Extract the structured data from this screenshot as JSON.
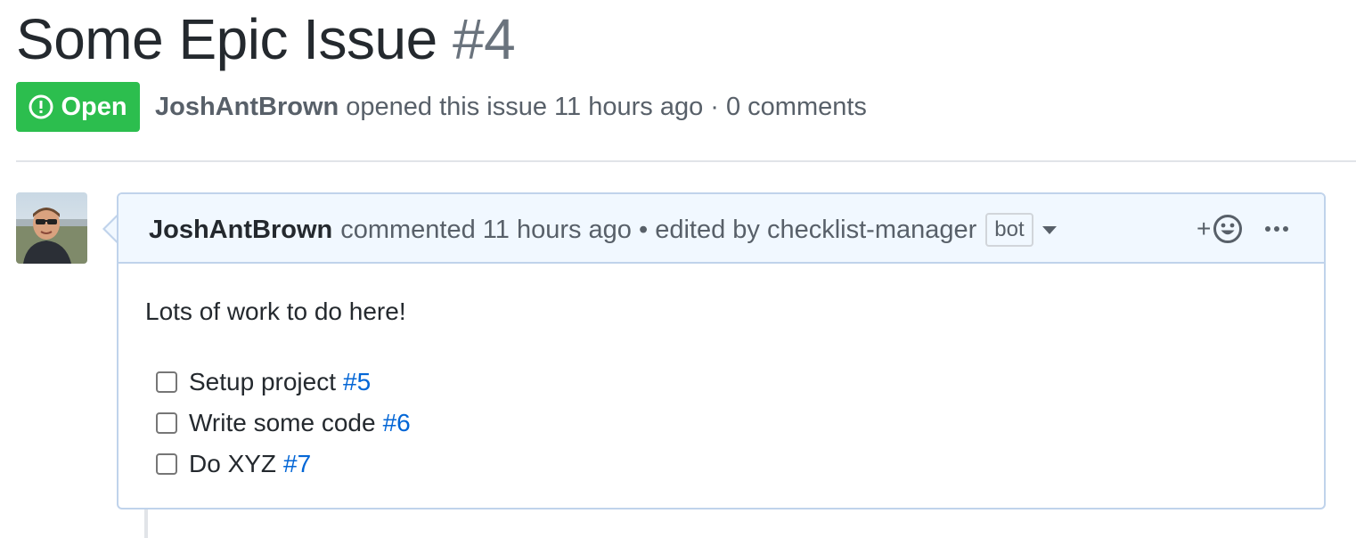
{
  "issue": {
    "title": "Some Epic Issue",
    "number": "#4",
    "state": "Open",
    "state_color": "#2cbe4e",
    "author": "JoshAntBrown",
    "opened_text": "opened this issue 11 hours ago · 0 comments"
  },
  "comment": {
    "author": "JoshAntBrown",
    "header_text": "commented 11 hours ago • edited by checklist-manager",
    "bot_label": "bot",
    "reaction_label": "+",
    "body": "Lots of work to do here!",
    "tasks": [
      {
        "label": "Setup project",
        "link": "#5"
      },
      {
        "label": "Write some code",
        "link": "#6"
      },
      {
        "label": "Do XYZ",
        "link": "#7"
      }
    ]
  },
  "icons": {
    "state": "issue-opened-icon",
    "reaction": "smiley-icon",
    "more": "kebab-horizontal-icon",
    "dropdown": "triangle-down-icon"
  },
  "colors": {
    "link": "#0366d6",
    "header_bg": "#f1f8ff",
    "border": "#c0d3eb"
  }
}
